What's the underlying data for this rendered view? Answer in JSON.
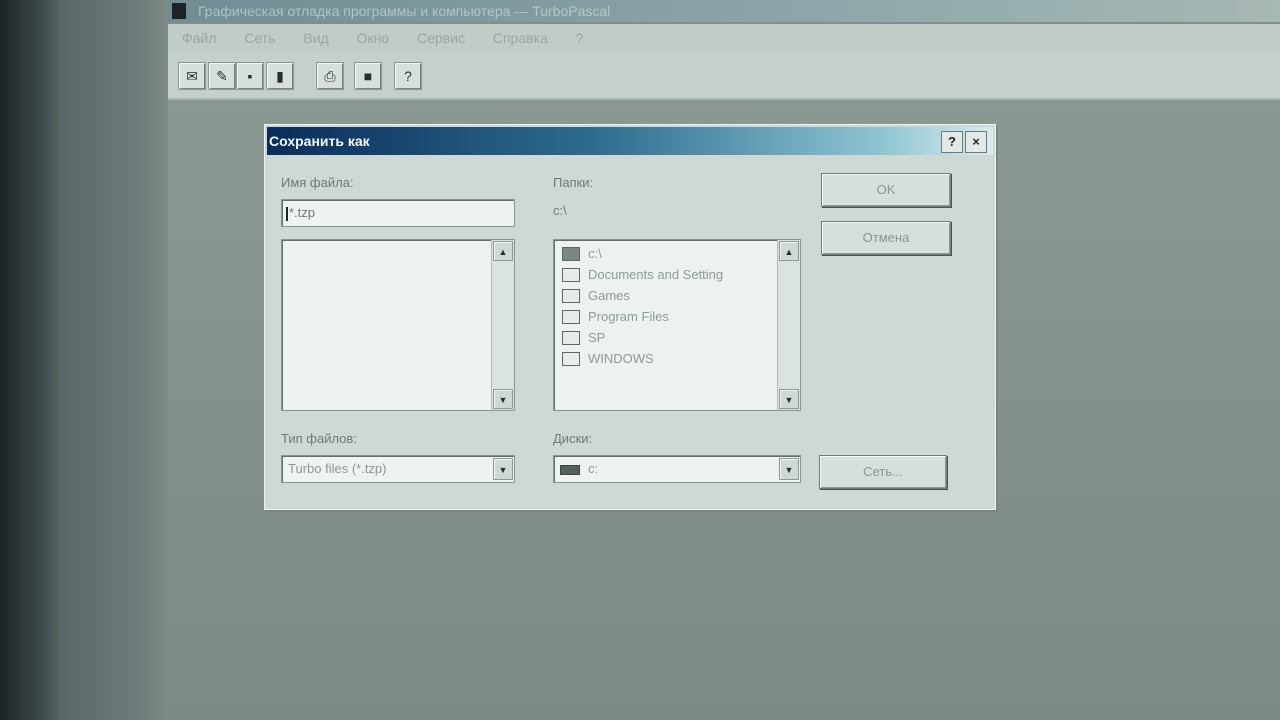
{
  "app": {
    "title": "Графическая отладка программы и компьютера — TurboPascal",
    "menu": [
      "Файл",
      "Сеть",
      "Вид",
      "Окно",
      "Сервис",
      "Справка",
      "?"
    ]
  },
  "toolbar": {
    "icons": [
      "open-icon",
      "save-icon",
      "print-icon",
      "bookmark-icon",
      "camera-icon",
      "stamp-icon",
      "help-icon"
    ],
    "help_label": "?"
  },
  "dialog": {
    "title": "Сохранить как",
    "help_button": "?",
    "close_button": "×",
    "filename_label": "Имя файла:",
    "filename_value": "*.tzp",
    "folders_label": "Папки:",
    "current_path": "c:\\",
    "folders": [
      {
        "name": "c:\\",
        "open": true
      },
      {
        "name": "Documents and Setting",
        "open": false
      },
      {
        "name": "Games",
        "open": false
      },
      {
        "name": "Program Files",
        "open": false
      },
      {
        "name": "SP",
        "open": false
      },
      {
        "name": "WINDOWS",
        "open": false
      }
    ],
    "filetype_label": "Тип файлов:",
    "filetype_value": "Turbo files (*.tzp)",
    "drives_label": "Диски:",
    "drive_value": "c:",
    "ok_button": "OK",
    "cancel_button": "Отмена",
    "network_button": "Сеть..."
  }
}
